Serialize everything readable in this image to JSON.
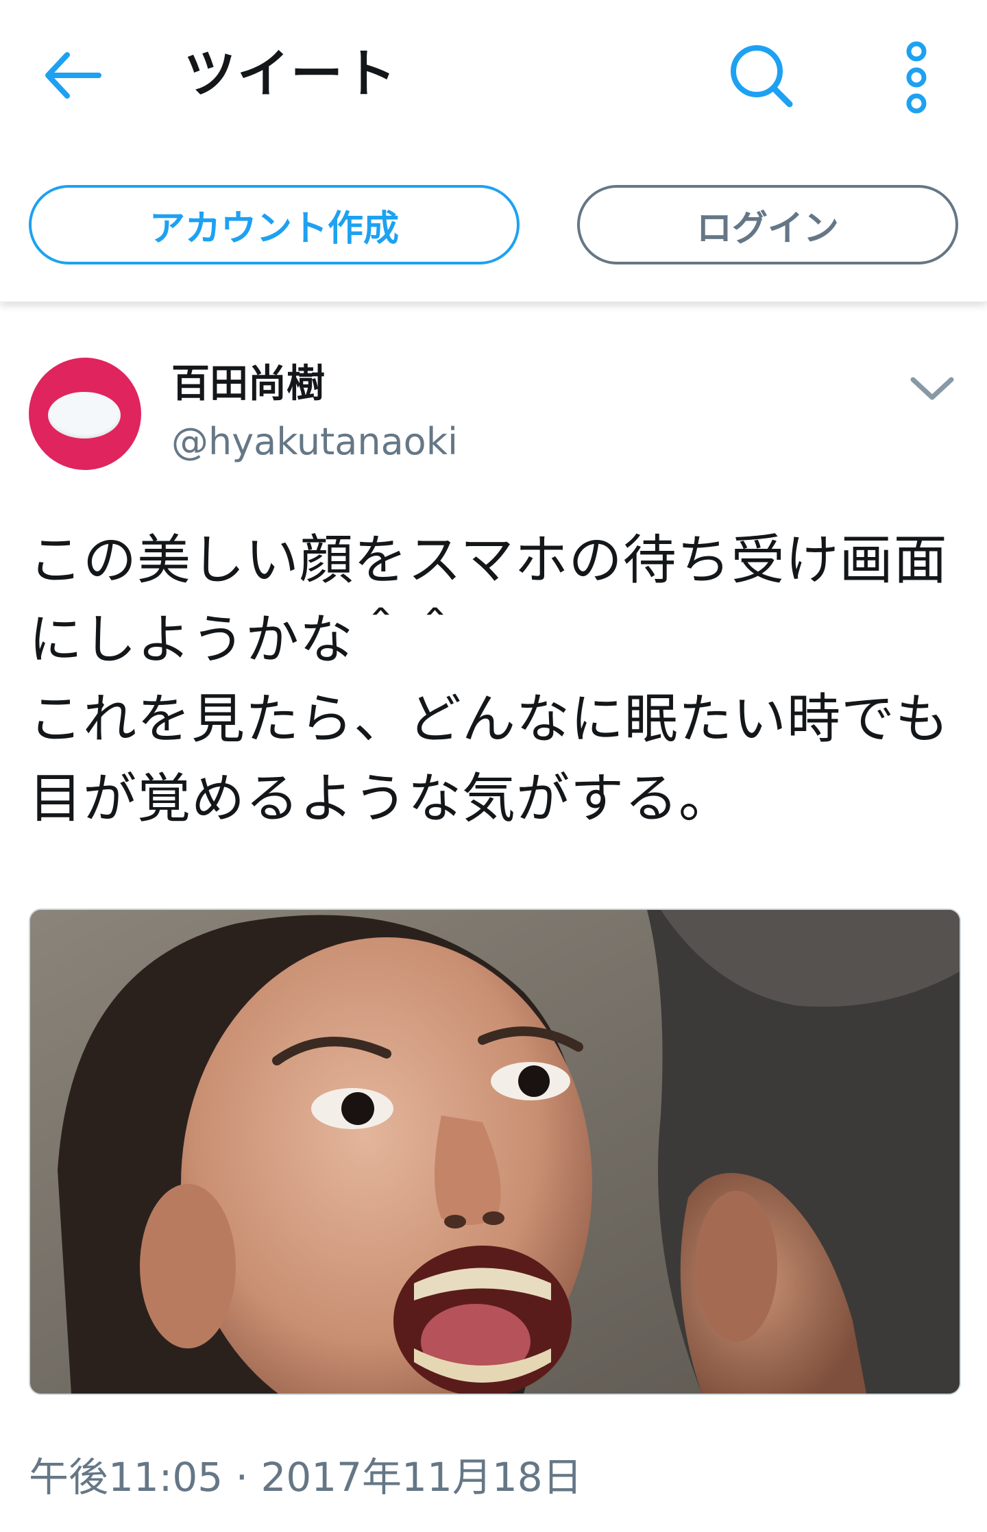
{
  "header": {
    "title": "ツイート",
    "back_icon": "arrow-left-icon",
    "search_icon": "search-icon",
    "more_icon": "more-vertical-icon"
  },
  "actions": {
    "signup_label": "アカウント作成",
    "login_label": "ログイン"
  },
  "tweet": {
    "author_name": "百田尚樹",
    "author_handle": "@hyakutanaoki",
    "text_lines": [
      "この美しい顔をスマホの待ち受け画面",
      "にしようかな＾＾",
      "これを見たら、どんなに眠たい時でも",
      "目が覚めるような気がする。"
    ],
    "timestamp": "午後11:05 · 2017年11月18日"
  },
  "colors": {
    "accent": "#1da1f2",
    "secondary_text": "#657786",
    "avatar_bg": "#e0245e"
  }
}
